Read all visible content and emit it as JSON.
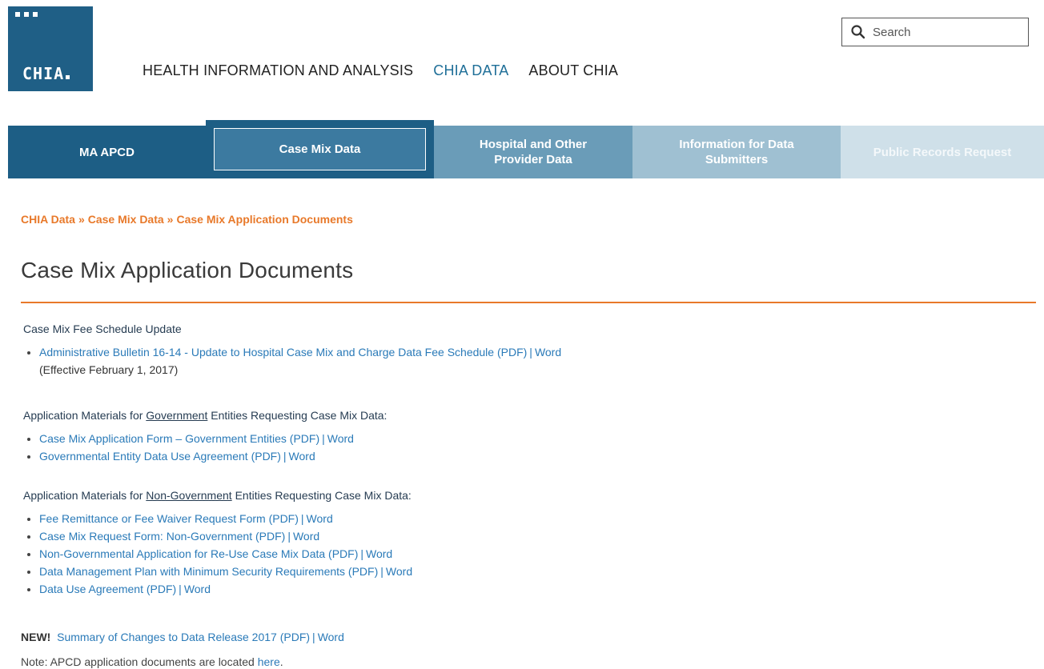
{
  "logo": {
    "text": "CHIA"
  },
  "topnav": [
    {
      "label": "HEALTH INFORMATION AND ANALYSIS",
      "active": false
    },
    {
      "label": "CHIA DATA",
      "active": true
    },
    {
      "label": "ABOUT CHIA",
      "active": false
    }
  ],
  "search": {
    "placeholder": "Search"
  },
  "tabs": [
    {
      "label": "MA APCD"
    },
    {
      "label": "Case Mix Data"
    },
    {
      "label": "Hospital and Other Provider Data"
    },
    {
      "label": "Information for Data Submitters"
    },
    {
      "label": "Public Records Request"
    }
  ],
  "breadcrumb": [
    "CHIA Data",
    "Case Mix Data",
    "Case Mix Application Documents"
  ],
  "breadcrumb_sep": "»",
  "page_title": "Case Mix Application Documents",
  "fee_section": {
    "heading": "Case Mix Fee Schedule Update",
    "items": [
      {
        "pdf": "Administrative Bulletin 16-14 - Update to Hospital Case Mix and Charge Data Fee Schedule (PDF)",
        "word": "Word",
        "extra": "(Effective February 1, 2017)"
      }
    ]
  },
  "gov_section": {
    "heading_pre": "Application Materials for ",
    "heading_u": "Government",
    "heading_post": " Entities Requesting Case Mix Data:",
    "items": [
      {
        "pdf": "Case Mix Application Form – Government Entities (PDF)",
        "word": "Word"
      },
      {
        "pdf": "Governmental Entity Data Use Agreement (PDF)",
        "word": "Word"
      }
    ]
  },
  "nongov_section": {
    "heading_pre": "Application Materials for ",
    "heading_u": "Non-Government",
    "heading_post": " Entities Requesting Case Mix Data:",
    "items": [
      {
        "pdf": "Fee Remittance or Fee Waiver Request Form (PDF)",
        "word": "Word"
      },
      {
        "pdf": "Case Mix Request Form: Non-Government (PDF)",
        "word": "Word"
      },
      {
        "pdf": "Non-Governmental Application for Re-Use Case Mix Data (PDF)",
        "word": "Word"
      },
      {
        "pdf": "Data Management Plan with Minimum Security Requirements (PDF)",
        "word": "Word"
      },
      {
        "pdf": "Data Use Agreement (PDF)",
        "word": "Word"
      }
    ]
  },
  "new_line": {
    "badge": "NEW!",
    "pdf": "Summary of Changes to Data Release 2017 (PDF)",
    "word": "Word"
  },
  "note": {
    "text": "Note: APCD application documents are located ",
    "link": "here",
    "end": "."
  },
  "separator": "|",
  "colors": {
    "brand_blue": "#1d5e85",
    "accent_orange": "#e8792a",
    "link_blue": "#2a7ab8"
  }
}
